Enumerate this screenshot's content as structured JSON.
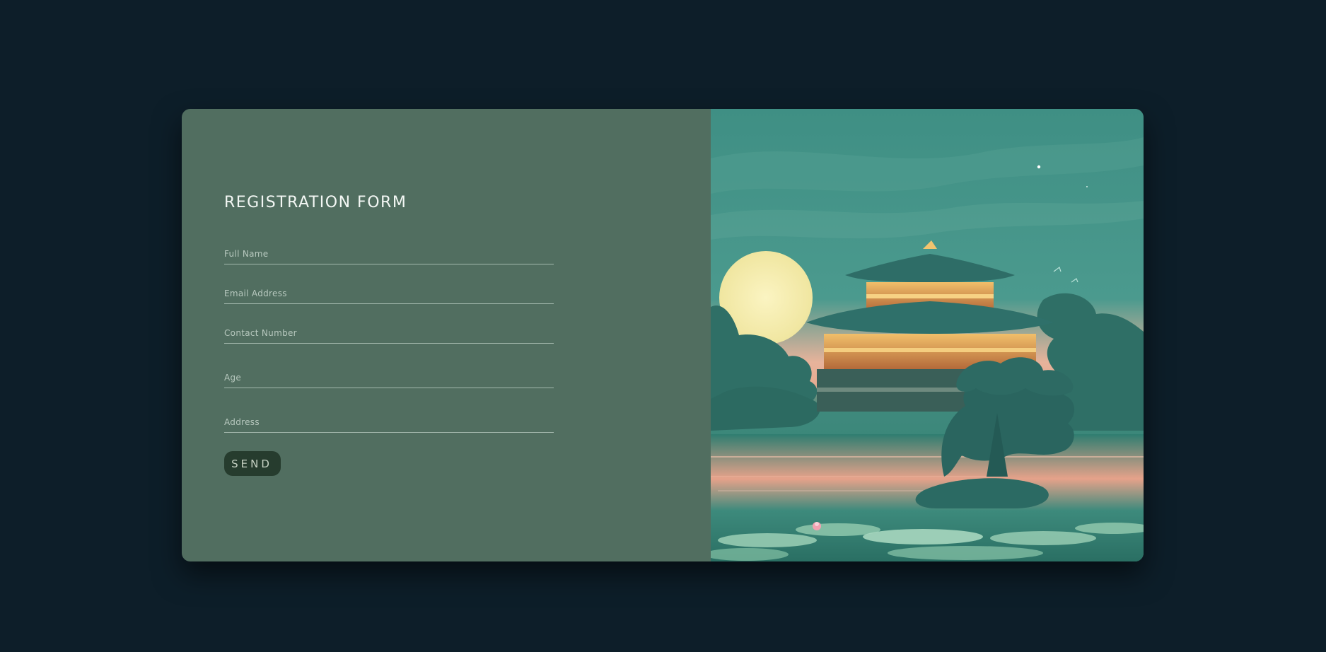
{
  "form": {
    "title": "REGISTRATION FORM",
    "fields": [
      {
        "name": "full-name",
        "placeholder": "Full Name"
      },
      {
        "name": "email",
        "placeholder": "Email Address"
      },
      {
        "name": "contact",
        "placeholder": "Contact Number"
      },
      {
        "name": "age",
        "placeholder": "Age"
      },
      {
        "name": "address",
        "placeholder": "Address"
      }
    ],
    "send_label": "SEND"
  },
  "colors": {
    "page_background": "#0d1e29",
    "form_panel": "#516e60",
    "button": "#263c2e",
    "accent_sky": "#3f8f84",
    "accent_moon": "#f6f0b6"
  },
  "illustration": {
    "icon": "pagoda-moonlit-lake-illustration"
  }
}
